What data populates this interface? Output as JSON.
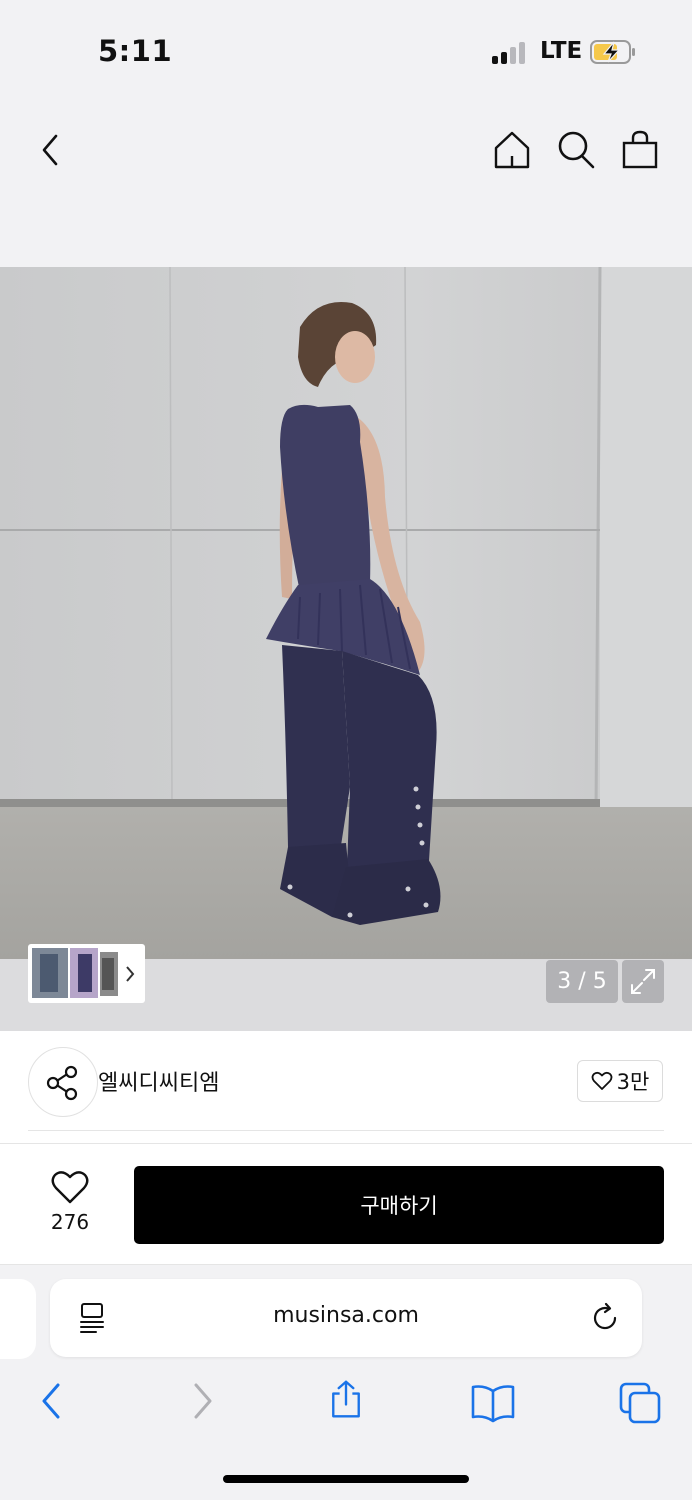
{
  "status_bar": {
    "time": "5:11",
    "network": "LTE",
    "battery": "charging"
  },
  "nav": {
    "icons": [
      "back-icon",
      "home-icon",
      "search-icon",
      "shopping-bag-icon"
    ]
  },
  "gallery": {
    "counter": "3 / 5",
    "current": 3,
    "total": 5
  },
  "brand": {
    "name": "엘씨디씨티엠",
    "like_count": "3만"
  },
  "purchase": {
    "wish_count": "276",
    "buy_label": "구매하기"
  },
  "browser": {
    "url": "musinsa.com"
  },
  "colors": {
    "buy_button": "#000000",
    "accent_blue": "#1a73e8",
    "battery_fill": "#f5c84a"
  }
}
